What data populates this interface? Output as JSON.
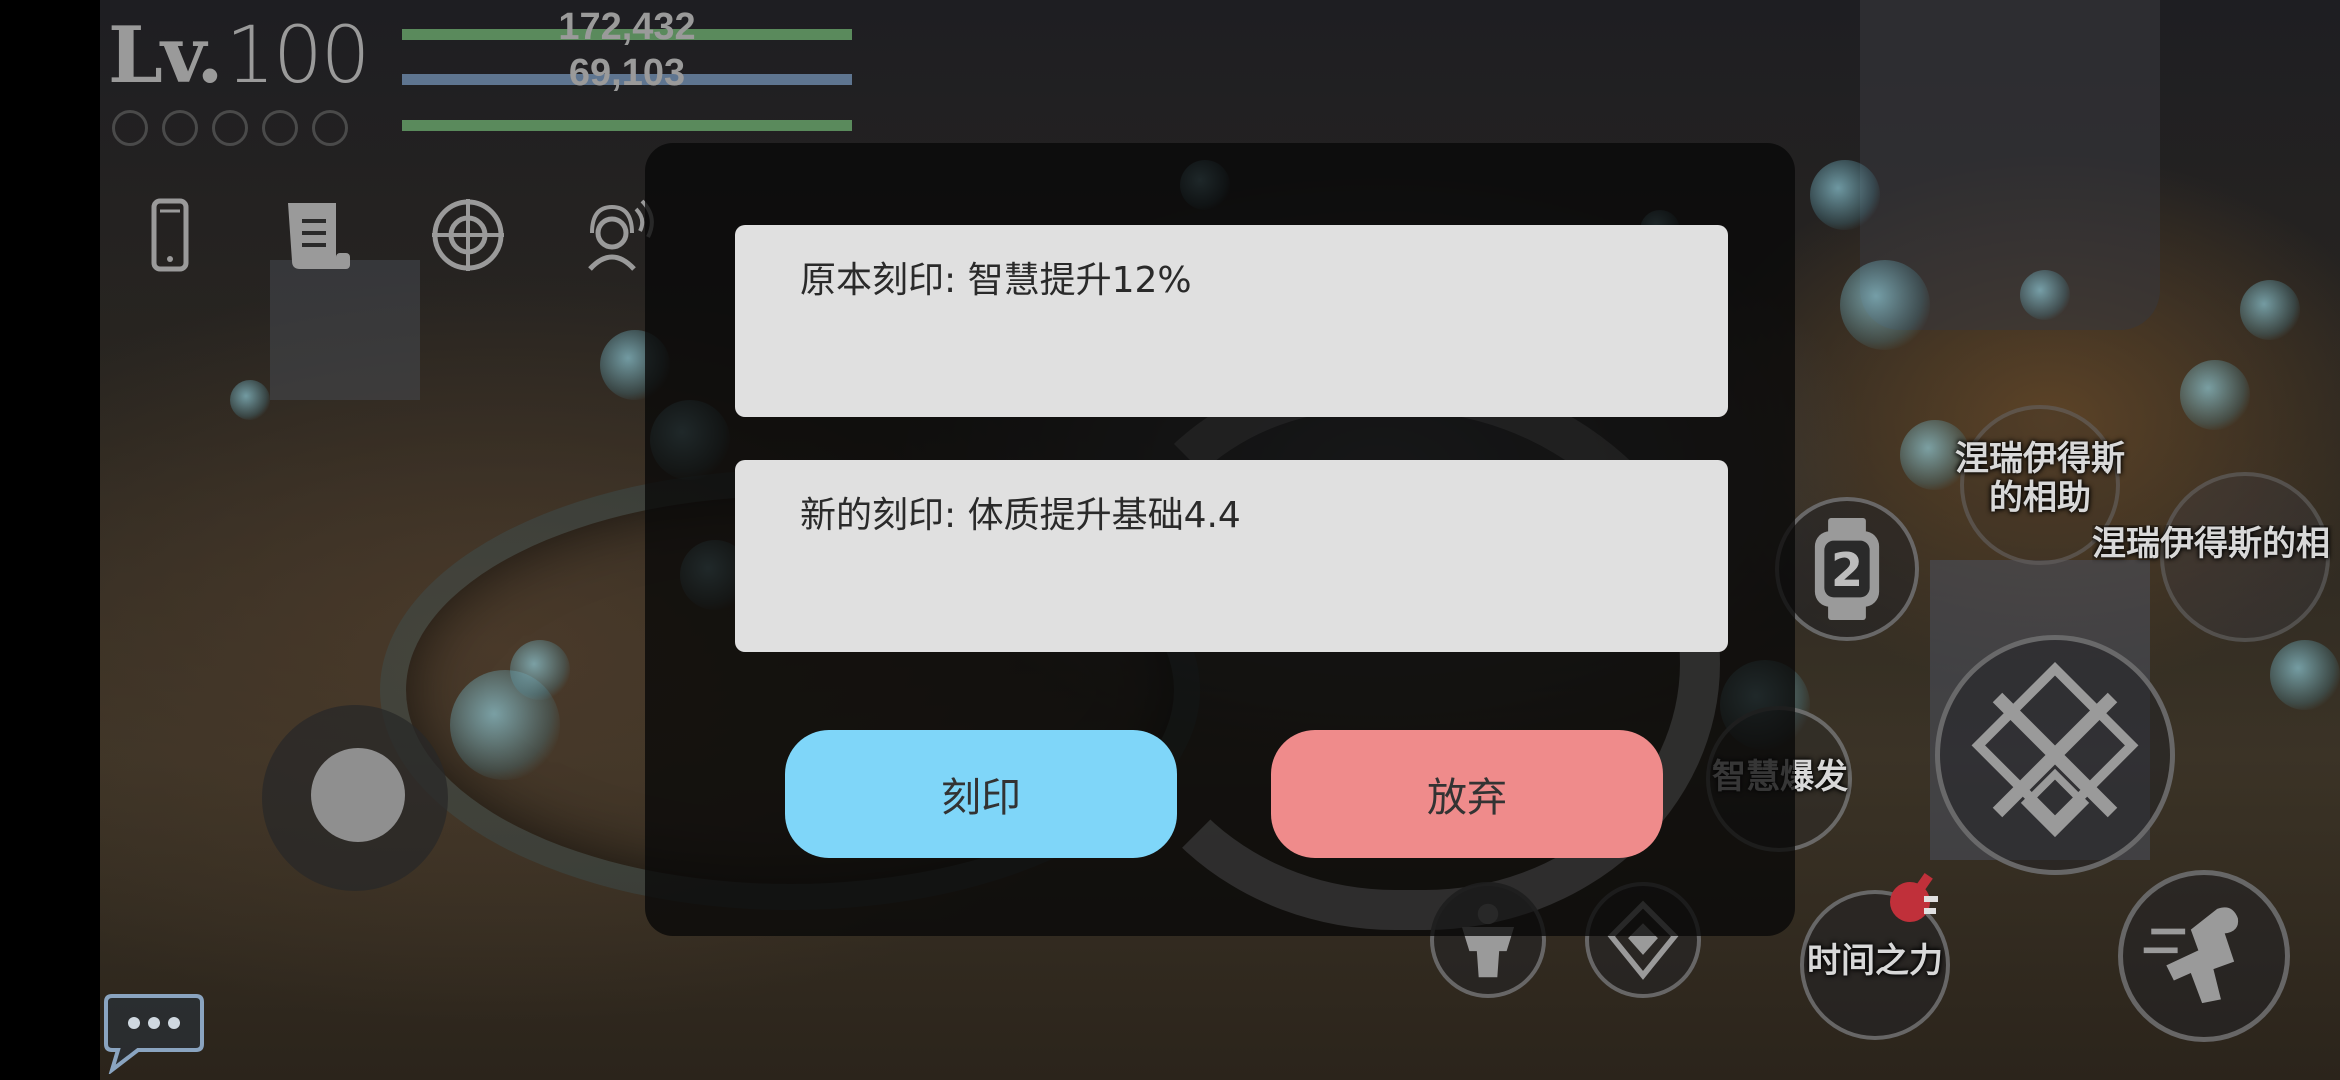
{
  "hud": {
    "level_prefix": "Lv.",
    "level_value": "100",
    "hp_value": "172,432",
    "mp_value": "69,103",
    "colors": {
      "hp": "#5a8a5c",
      "mp": "#5e7590",
      "exp": "#5a8a5c"
    },
    "icons": [
      "phone-icon",
      "scroll-icon",
      "crosshair-icon",
      "headset-icon"
    ]
  },
  "dialog": {
    "original_engraving": "原本刻印: 智慧提升12%",
    "new_engraving": "新的刻印: 体质提升基础4.4",
    "engrave_button": "刻印",
    "discard_button": "放弃",
    "colors": {
      "engrave": "#7fd6f9",
      "discard": "#ef8b8b",
      "card": "#e0e0e0"
    }
  },
  "skills": {
    "watch_skill_number": "2",
    "wisdom_burst": "智慧爆发",
    "time_power": "时间之力",
    "nereides_help_1_line1": "涅瑞伊得斯",
    "nereides_help_1_line2": "的相助",
    "nereides_help_2": "涅瑞伊得斯的相"
  }
}
